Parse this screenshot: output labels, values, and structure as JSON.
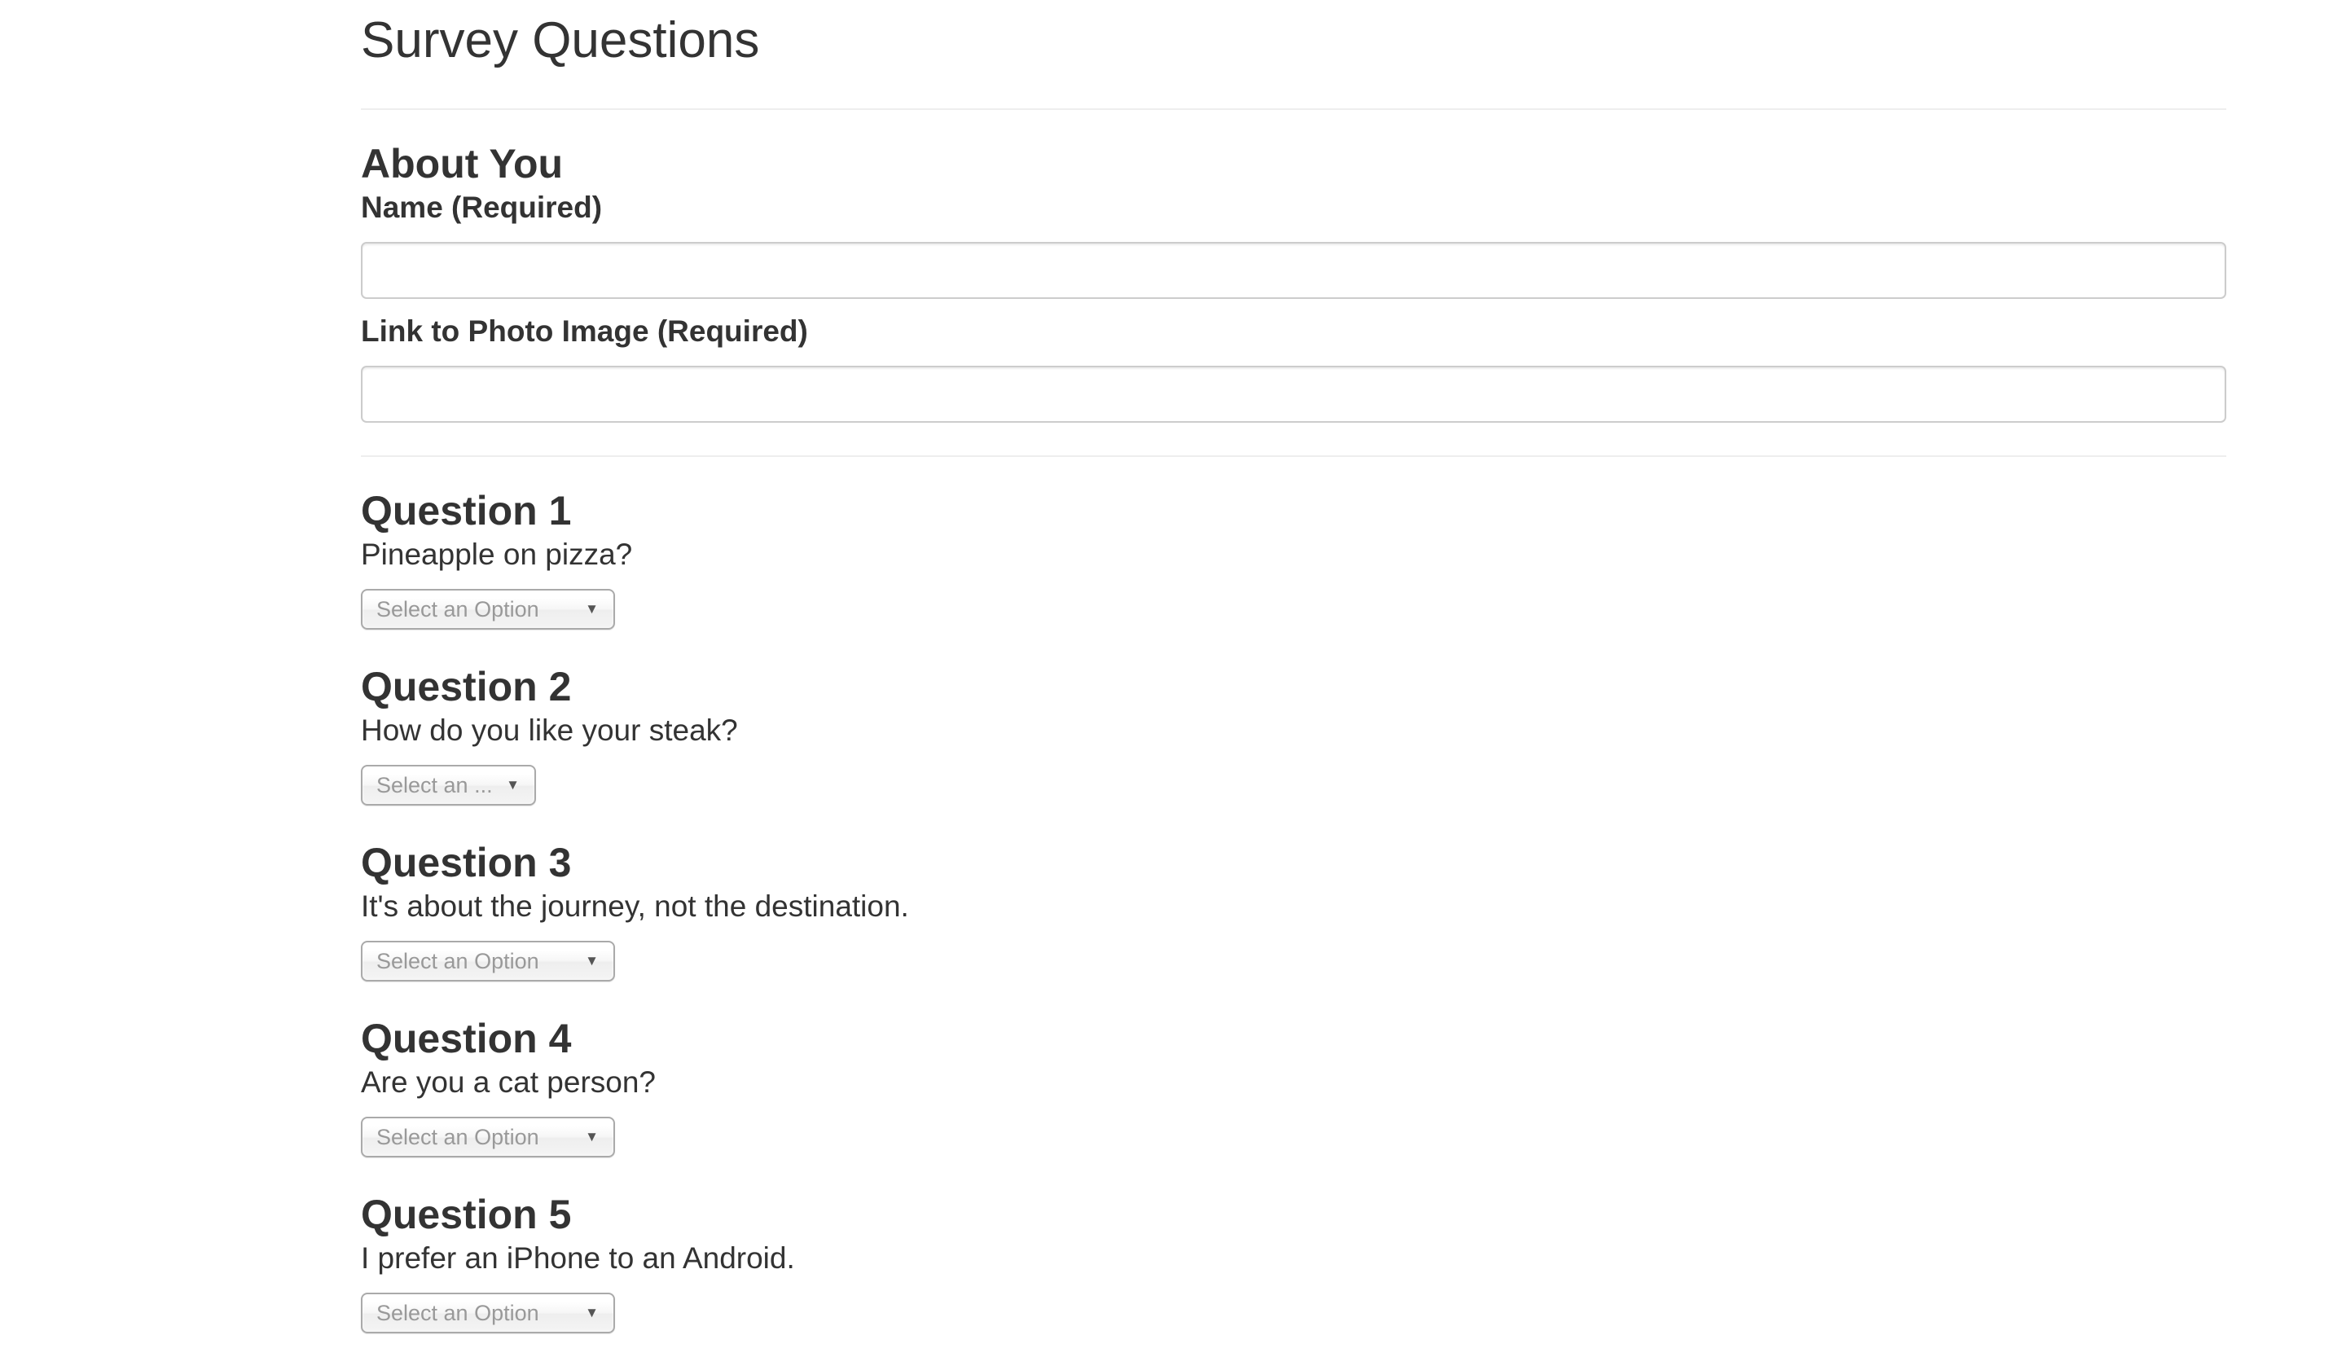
{
  "page": {
    "title": "Survey Questions"
  },
  "about": {
    "heading": "About You",
    "name_label": "Name (Required)",
    "name_value": "",
    "photo_label": "Link to Photo Image (Required)",
    "photo_value": ""
  },
  "questions": [
    {
      "title": "Question 1",
      "text": "Pineapple on pizza?",
      "select_value": "Select an Option",
      "arrow_icon": "triangle-down-icon"
    },
    {
      "title": "Question 2",
      "text": "How do you like your steak?",
      "select_value": "Select an ...",
      "arrow_icon": "triangle-down-icon"
    },
    {
      "title": "Question 3",
      "text": "It's about the journey, not the destination.",
      "select_value": "Select an Option",
      "arrow_icon": "triangle-down-icon"
    },
    {
      "title": "Question 4",
      "text": "Are you a cat person?",
      "select_value": "Select an Option",
      "arrow_icon": "triangle-down-icon"
    },
    {
      "title": "Question 5",
      "text": "I prefer an iPhone to an Android.",
      "select_value": "Select an Option",
      "arrow_icon": "triangle-down-icon"
    }
  ],
  "colors": {
    "text": "#333333",
    "placeholder": "#999999",
    "border": "#cccccc",
    "rule": "#eeeeee"
  }
}
